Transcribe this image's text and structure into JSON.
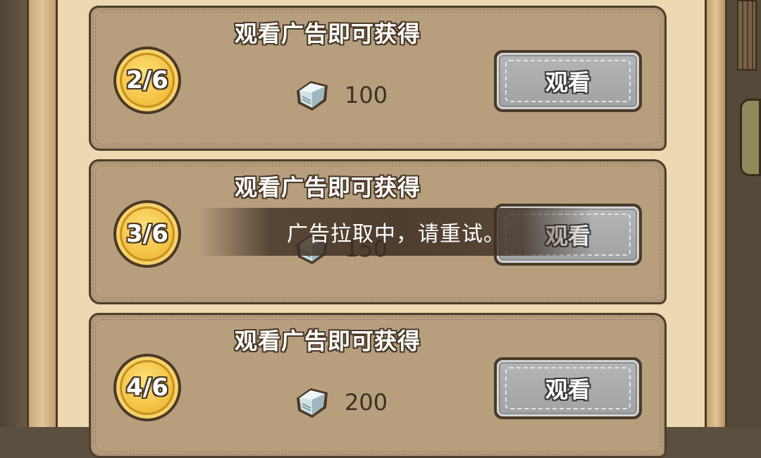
{
  "rewards": [
    {
      "progress": "2/6",
      "title": "观看广告即可获得",
      "icon": "diamond-gem-icon",
      "amount": "100",
      "button_label": "观看"
    },
    {
      "progress": "3/6",
      "title": "观看广告即可获得",
      "icon": "diamond-gem-icon",
      "amount": "150",
      "button_label": "观看"
    },
    {
      "progress": "4/6",
      "title": "观看广告即可获得",
      "icon": "diamond-gem-icon",
      "amount": "200",
      "button_label": "观看"
    }
  ],
  "toast": {
    "message": "广告拉取中，请重试。",
    "background_color": "#3c2d20"
  },
  "colors": {
    "card_bg": "#b79f7e",
    "panel_bg": "#ecd9b2",
    "badge_gold": "#f3c244",
    "button_gray": "#a0a1a3",
    "outline": "#4a3a28"
  }
}
